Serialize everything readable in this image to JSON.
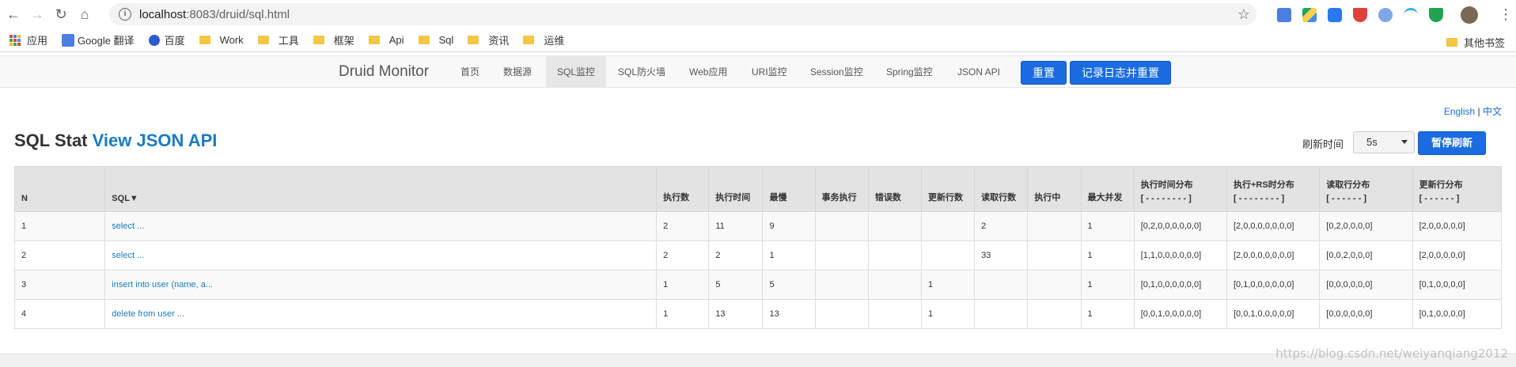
{
  "browser": {
    "url_host": "localhost",
    "url_rest": ":8083/druid/sql.html",
    "bookmarks": [
      {
        "label": "应用",
        "icon": "apps-icon"
      },
      {
        "label": "Google 翻译",
        "icon": "google-translate-icon"
      },
      {
        "label": "百度",
        "icon": "baidu-icon"
      },
      {
        "label": "Work",
        "icon": "folder-icon"
      },
      {
        "label": "工具",
        "icon": "folder-icon"
      },
      {
        "label": "框架",
        "icon": "folder-icon"
      },
      {
        "label": "Api",
        "icon": "folder-icon"
      },
      {
        "label": "Sql",
        "icon": "folder-icon"
      },
      {
        "label": "资讯",
        "icon": "folder-icon"
      },
      {
        "label": "运维",
        "icon": "folder-icon"
      }
    ],
    "other_bookmarks": "其他书签"
  },
  "druid_nav": {
    "brand": "Druid Monitor",
    "items": [
      "首页",
      "数据源",
      "SQL监控",
      "SQL防火墙",
      "Web应用",
      "URI监控",
      "Session监控",
      "Spring监控",
      "JSON API"
    ],
    "active": "SQL监控",
    "reset_label": "重置",
    "log_reset_label": "记录日志并重置"
  },
  "lang": {
    "english": "English",
    "sep": "|",
    "chinese": "中文"
  },
  "page": {
    "title_prefix": "SQL Stat",
    "title_link": "View JSON API",
    "refresh_label": "刷新时间",
    "refresh_value": "5s",
    "pause_label": "暂停刷新"
  },
  "table": {
    "headers": [
      {
        "label": "N",
        "sub": ""
      },
      {
        "label": "SQL▼",
        "sub": ""
      },
      {
        "label": "执行数",
        "sub": ""
      },
      {
        "label": "执行时间",
        "sub": ""
      },
      {
        "label": "最慢",
        "sub": ""
      },
      {
        "label": "事务执行",
        "sub": ""
      },
      {
        "label": "错误数",
        "sub": ""
      },
      {
        "label": "更新行数",
        "sub": ""
      },
      {
        "label": "读取行数",
        "sub": ""
      },
      {
        "label": "执行中",
        "sub": ""
      },
      {
        "label": "最大并发",
        "sub": ""
      },
      {
        "label": "执行时间分布",
        "sub": "[ - - - - - - - - ]"
      },
      {
        "label": "执行+RS时分布",
        "sub": "[ - - - - - - - - ]"
      },
      {
        "label": "读取行分布",
        "sub": "[ - - - - - - ]"
      },
      {
        "label": "更新行分布",
        "sub": "[ - - - - - - ]"
      }
    ],
    "rows": [
      [
        "1",
        "select ...",
        "2",
        "11",
        "9",
        "",
        "",
        "",
        "2",
        "",
        "1",
        "[0,2,0,0,0,0,0,0]",
        "[2,0,0,0,0,0,0,0]",
        "[0,2,0,0,0,0]",
        "[2,0,0,0,0,0]"
      ],
      [
        "2",
        "select ...",
        "2",
        "2",
        "1",
        "",
        "",
        "",
        "33",
        "",
        "1",
        "[1,1,0,0,0,0,0,0]",
        "[2,0,0,0,0,0,0,0]",
        "[0,0,2,0,0,0]",
        "[2,0,0,0,0,0]"
      ],
      [
        "3",
        "insert into user (name, a...",
        "1",
        "5",
        "5",
        "",
        "",
        "1",
        "",
        "",
        "1",
        "[0,1,0,0,0,0,0,0]",
        "[0,1,0,0,0,0,0,0]",
        "[0,0,0,0,0,0]",
        "[0,1,0,0,0,0]"
      ],
      [
        "4",
        "delete from user ...",
        "1",
        "13",
        "13",
        "",
        "",
        "1",
        "",
        "",
        "1",
        "[0,0,1,0,0,0,0,0]",
        "[0,0,1,0,0,0,0,0]",
        "[0,0,0,0,0,0]",
        "[0,1,0,0,0,0]"
      ]
    ]
  },
  "watermark": "https://blog.csdn.net/weiyanqiang2012"
}
